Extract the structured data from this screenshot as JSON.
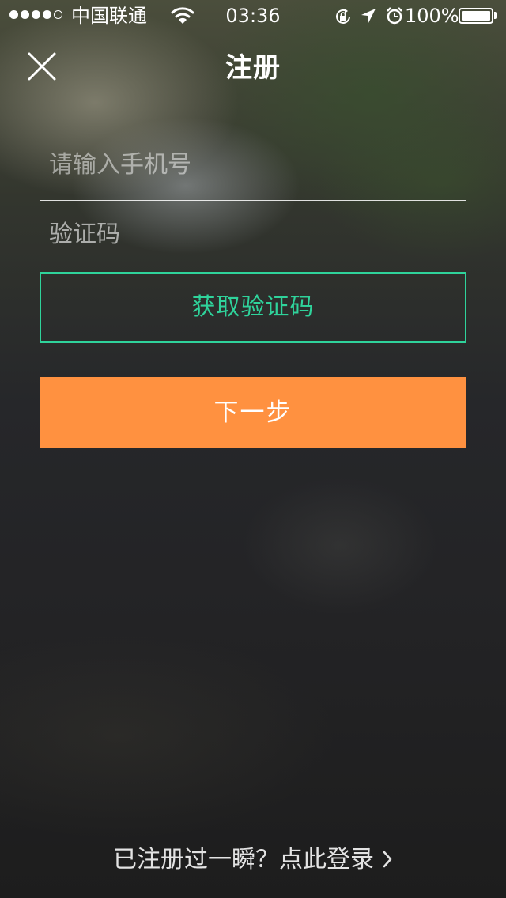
{
  "status_bar": {
    "signal_bars_filled": 4,
    "signal_bars_total": 5,
    "carrier": "中国联通",
    "time": "03:36",
    "battery_percent": "100%",
    "battery_level": 1.0,
    "icons": [
      "wifi-icon",
      "rotation-lock-icon",
      "location-arrow-icon",
      "alarm-icon",
      "battery-icon"
    ]
  },
  "nav": {
    "title": "注册",
    "close_icon": "close-icon"
  },
  "form": {
    "phone_placeholder": "请输入手机号",
    "code_placeholder": "验证码",
    "get_code_label": "获取验证码",
    "next_label": "下一步"
  },
  "footer": {
    "login_text": "已注册过一瞬？点此登录",
    "chevron_icon": "chevron-right-icon"
  },
  "colors": {
    "accent_green": "#2fd39b",
    "accent_orange": "#ff9140"
  }
}
